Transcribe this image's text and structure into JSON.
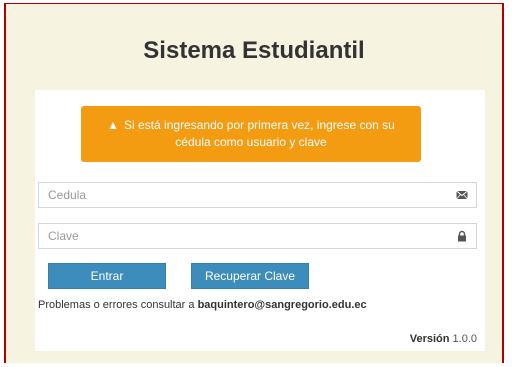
{
  "page": {
    "title": "Sistema Estudiantil"
  },
  "alert": {
    "icon": "warning-icon",
    "line1": "Si está ingresando por primera vez, ingrese con su",
    "line2": "cédula como usuario y clave",
    "color": "#f39c12"
  },
  "form": {
    "cedula": {
      "placeholder": "Cedula",
      "value": "",
      "icon": "envelope-icon"
    },
    "clave": {
      "placeholder": "Clave",
      "value": "",
      "icon": "lock-icon"
    },
    "login_label": "Entrar",
    "recover_label": "Recuperar Clave",
    "button_color": "#3c8dbc"
  },
  "footer": {
    "info_prefix": "Problemas o errores consultar a",
    "contact_email": "baquintero@sangregorio.edu.ec",
    "version_label": "Versión",
    "version_number": "1.0.0"
  }
}
